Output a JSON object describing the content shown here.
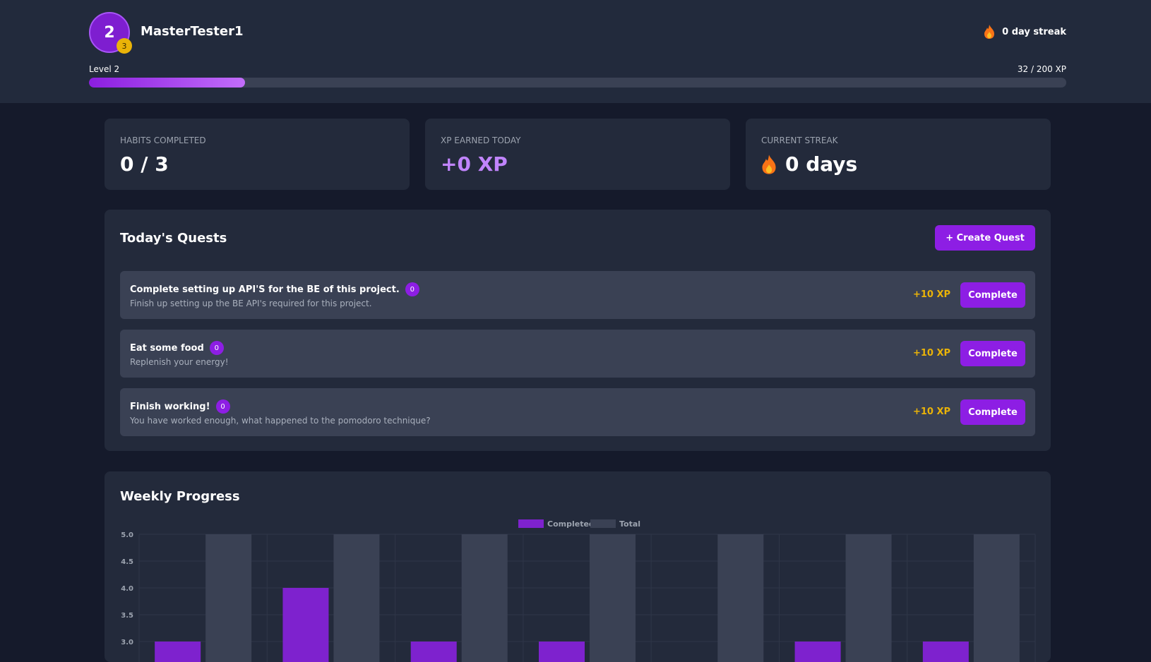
{
  "header": {
    "level_number": "2",
    "badge_number": "3",
    "username": "MasterTester1",
    "streak_text": "0 day streak",
    "level_label": "Level 2",
    "xp_text": "32 / 200 XP",
    "xp_progress": 0.16
  },
  "stats": [
    {
      "label": "HABITS COMPLETED",
      "value": "0 / 3"
    },
    {
      "label": "XP EARNED TODAY",
      "value": "+0 XP"
    },
    {
      "label": "CURRENT STREAK",
      "value": "0 days"
    }
  ],
  "quests_section": {
    "title": "Today's Quests",
    "create_button": "+ Create Quest",
    "quests": [
      {
        "title": "Complete setting up API'S for the BE of this project.",
        "count": "0",
        "description": "Finish up setting up the BE API's required for this project.",
        "xp": "+10 XP",
        "button": "Complete"
      },
      {
        "title": "Eat some food",
        "count": "0",
        "description": "Replenish your energy!",
        "xp": "+10 XP",
        "button": "Complete"
      },
      {
        "title": "Finish working!",
        "count": "0",
        "description": "You have worked enough, what happened to the pomodoro technique?",
        "xp": "+10 XP",
        "button": "Complete"
      }
    ]
  },
  "weekly": {
    "title": "Weekly Progress"
  },
  "colors": {
    "accent": "#8d1ee4",
    "completed_bar": "#7e22ce",
    "total_bar": "#3a4154",
    "xp_yellow": "#eab308",
    "flame": "#f97316"
  },
  "chart_data": {
    "type": "bar",
    "legend": [
      "Completed",
      "Total"
    ],
    "legend_position": "top",
    "series": [
      {
        "name": "Completed",
        "values": [
          3,
          4,
          3,
          3,
          0,
          3,
          3
        ]
      },
      {
        "name": "Total",
        "values": [
          5,
          5,
          5,
          5,
          5,
          5,
          5
        ]
      }
    ],
    "y_ticks": [
      "5.0",
      "4.5",
      "4.0",
      "3.5",
      "3.0"
    ],
    "ylim_visible": [
      3.0,
      5.0
    ],
    "grid": true
  }
}
